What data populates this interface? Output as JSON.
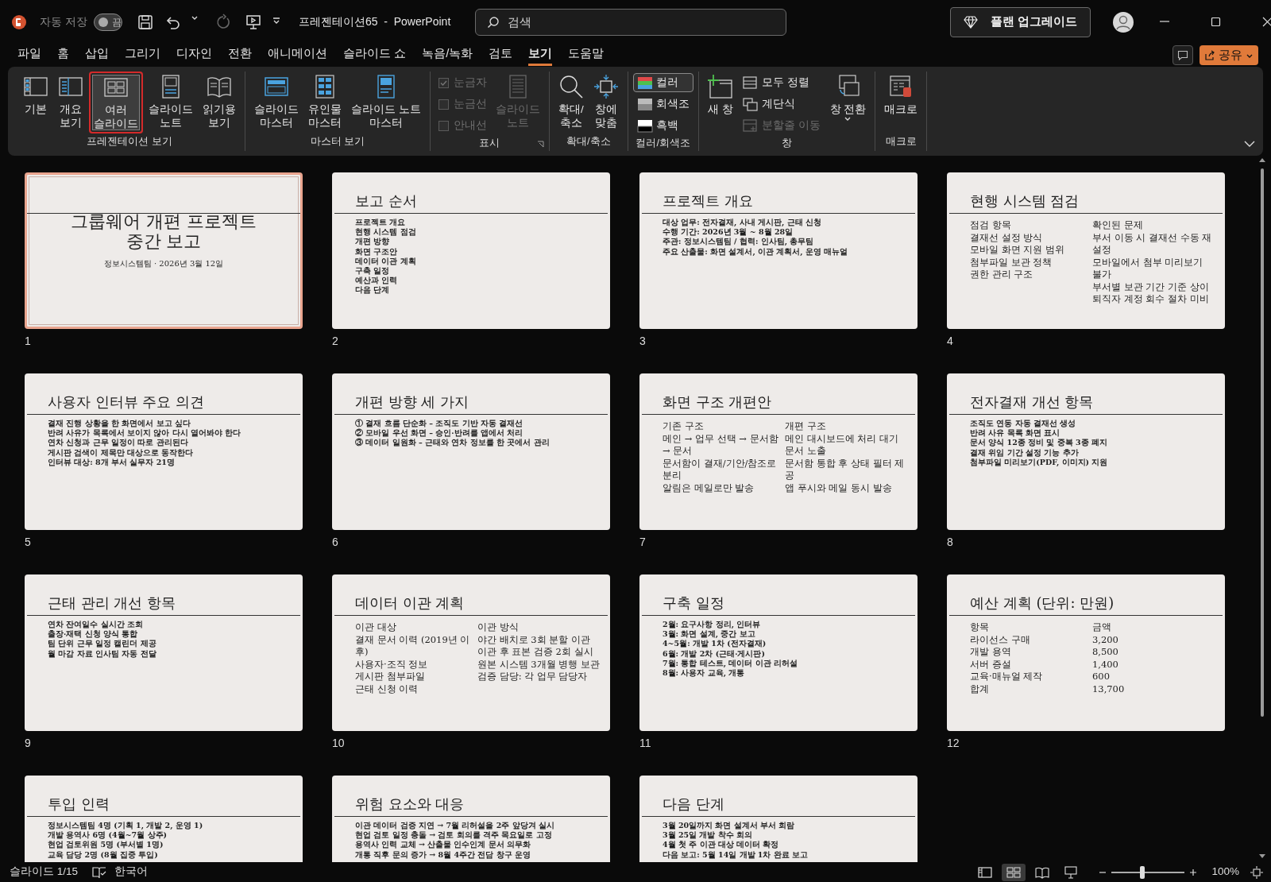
{
  "titlebar": {
    "autosave_label": "자동 저장",
    "autosave": {
      "on": false,
      "label": "끔"
    },
    "doc_title": "프레젠테이션65  -  PowerPoint",
    "search": {
      "placeholder": "검색"
    },
    "upgrade_button": "플랜 업그레이드"
  },
  "menu_tabs": [
    {
      "label": "파일",
      "selected": false
    },
    {
      "label": "홈",
      "selected": false
    },
    {
      "label": "삽입",
      "selected": false
    },
    {
      "label": "그리기",
      "selected": false
    },
    {
      "label": "디자인",
      "selected": false
    },
    {
      "label": "전환",
      "selected": false
    },
    {
      "label": "애니메이션",
      "selected": false
    },
    {
      "label": "슬라이드 쇼",
      "selected": false
    },
    {
      "label": "녹음/녹화",
      "selected": false
    },
    {
      "label": "검토",
      "selected": false
    },
    {
      "label": "보기",
      "selected": true
    },
    {
      "label": "도움말",
      "selected": false
    }
  ],
  "share_button": "공유",
  "ribbon_groups": [
    {
      "label": "프레젠테이션 보기",
      "launcher": false,
      "items": [
        {
          "kind": "large",
          "label": "기본",
          "disabled": false,
          "selected": false
        },
        {
          "kind": "large",
          "label": "개요\n보기",
          "disabled": false,
          "selected": false
        },
        {
          "kind": "large",
          "label": "여러\n슬라이드",
          "disabled": false,
          "selected": true
        },
        {
          "kind": "large",
          "label": "슬라이드\n노트",
          "disabled": false,
          "selected": false
        },
        {
          "kind": "large",
          "label": "읽기용\n보기",
          "disabled": false,
          "selected": false
        }
      ]
    },
    {
      "label": "마스터 보기",
      "launcher": false,
      "items": [
        {
          "kind": "large",
          "label": "슬라이드\n마스터",
          "disabled": false,
          "selected": false
        },
        {
          "kind": "large",
          "label": "유인물\n마스터",
          "disabled": false,
          "selected": false
        },
        {
          "kind": "large",
          "label": "슬라이드 노트\n마스터",
          "disabled": false,
          "selected": false
        }
      ]
    },
    {
      "label": "표시",
      "launcher": true,
      "items": [
        {
          "kind": "check",
          "label": "눈금자",
          "disabled": true,
          "checked": true
        },
        {
          "kind": "check",
          "label": "눈금선",
          "disabled": true,
          "checked": false
        },
        {
          "kind": "check",
          "label": "안내선",
          "disabled": true,
          "checked": false
        },
        {
          "kind": "large",
          "label": "슬라이드\n노트",
          "disabled": true,
          "selected": false
        }
      ]
    },
    {
      "label": "확대/축소",
      "launcher": false,
      "items": [
        {
          "kind": "large",
          "label": "확대/\n축소",
          "disabled": false,
          "selected": false
        },
        {
          "kind": "large",
          "label": "창에\n맞춤",
          "disabled": false,
          "selected": false
        }
      ]
    },
    {
      "label": "컬러/회색조",
      "launcher": false,
      "items": [
        {
          "kind": "small",
          "label": "컬러",
          "disabled": false,
          "selected": true
        },
        {
          "kind": "small",
          "label": "회색조",
          "disabled": false,
          "selected": false
        },
        {
          "kind": "small",
          "label": "흑백",
          "disabled": false,
          "selected": false
        }
      ]
    },
    {
      "label": "창",
      "launcher": false,
      "items": [
        {
          "kind": "large",
          "label": "새 창",
          "disabled": false,
          "selected": false
        },
        {
          "kind": "small",
          "label": "모두 정렬",
          "disabled": false,
          "selected": false
        },
        {
          "kind": "small",
          "label": "계단식",
          "disabled": false,
          "selected": false
        },
        {
          "kind": "small",
          "label": "분할줄 이동",
          "disabled": true,
          "selected": false
        },
        {
          "kind": "large",
          "label": "창 전환",
          "disabled": false,
          "selected": false,
          "dropdown": true
        }
      ]
    },
    {
      "label": "매크로",
      "launcher": false,
      "items": [
        {
          "kind": "large",
          "label": "매크로",
          "disabled": false,
          "selected": false
        }
      ]
    }
  ],
  "slides": [
    {
      "number": "1",
      "kind": "title",
      "selected": true,
      "title_lines": [
        "그룹웨어 개편 프로젝트",
        "중간 보고"
      ],
      "subtitle": "정보시스템팀 · 2026년 3월 12일"
    },
    {
      "number": "2",
      "kind": "list",
      "selected": false,
      "title": "보고 순서",
      "lines": [
        "프로젝트 개요",
        "현행 시스템 점검",
        "개편 방향",
        "화면 구조안",
        "데이터 이관 계획",
        "구축 일정",
        "예산과 인력",
        "다음 단계"
      ]
    },
    {
      "number": "3",
      "kind": "list",
      "selected": false,
      "title": "프로젝트 개요",
      "lines": [
        "대상 업무: 전자결재, 사내 게시판, 근태 신청",
        "수행 기간: 2026년 3월 ~ 8월 28일",
        "주관: 정보시스템팀 / 협력: 인사팀, 총무팀",
        "주요 산출물: 화면 설계서, 이관 계획서, 운영 매뉴얼"
      ]
    },
    {
      "number": "4",
      "kind": "two_column",
      "selected": false,
      "title": "현행 시스템 점검",
      "columns": [
        [
          "점검 항목",
          "결재선 설정 방식",
          "모바일 화면 지원 범위",
          "첨부파일 보관 정책",
          "권한 관리 구조"
        ],
        [
          "확인된 문제",
          "부서 이동 시 결재선 수동 재설정",
          "모바일에서 첨부 미리보기 불가",
          "부서별 보관 기간 기준 상이",
          "퇴직자 계정 회수 절차 미비"
        ]
      ]
    },
    {
      "number": "5",
      "kind": "list",
      "selected": false,
      "title": "사용자 인터뷰 주요 의견",
      "lines": [
        "결재 진행 상황을 한 화면에서 보고 싶다",
        "반려 사유가 목록에서 보이지 않아 다시 열어봐야 한다",
        "연차 신청과 근무 일정이 따로 관리된다",
        "게시판 검색이 제목만 대상으로 동작한다",
        "인터뷰 대상: 8개 부서 실무자 21명"
      ]
    },
    {
      "number": "6",
      "kind": "list",
      "selected": false,
      "title": "개편 방향 세 가지",
      "lines": [
        "① 결재 흐름 단순화 – 조직도 기반 자동 결재선",
        "② 모바일 우선 화면 – 승인·반려를 앱에서 처리",
        "③ 데이터 일원화 – 근태와 연차 정보를 한 곳에서 관리"
      ]
    },
    {
      "number": "7",
      "kind": "two_column",
      "selected": false,
      "title": "화면 구조 개편안",
      "columns": [
        [
          "기존 구조",
          "메인 → 업무 선택 → 문서함 → 문서",
          "문서함이 결재/기안/참조로 분리",
          "알림은 메일로만 발송"
        ],
        [
          "개편 구조",
          "메인 대시보드에 처리 대기 문서 노출",
          "문서함 통합 후 상태 필터 제공",
          "앱 푸시와 메일 동시 발송"
        ]
      ]
    },
    {
      "number": "8",
      "kind": "list",
      "selected": false,
      "title": "전자결재 개선 항목",
      "lines": [
        "조직도 연동 자동 결재선 생성",
        "반려 사유 목록 화면 표시",
        "문서 양식 12종 정비 및 중복 3종 폐지",
        "결재 위임 기간 설정 기능 추가",
        "첨부파일 미리보기(PDF, 이미지) 지원"
      ]
    },
    {
      "number": "9",
      "kind": "list",
      "selected": false,
      "title": "근태 관리 개선 항목",
      "lines": [
        "연차 잔여일수 실시간 조회",
        "출장·재택 신청 양식 통합",
        "팀 단위 근무 일정 캘린더 제공",
        "월 마감 자료 인사팀 자동 전달"
      ]
    },
    {
      "number": "10",
      "kind": "two_column",
      "selected": false,
      "title": "데이터 이관 계획",
      "columns": [
        [
          "이관 대상",
          "결재 문서 이력 (2019년 이후)",
          "사용자·조직 정보",
          "게시판 첨부파일",
          "근태 신청 이력"
        ],
        [
          "이관 방식",
          "야간 배치로 3회 분할 이관",
          "이관 후 표본 검증 2회 실시",
          "원본 시스템 3개월 병행 보관",
          "검증 담당: 각 업무 담당자"
        ]
      ]
    },
    {
      "number": "11",
      "kind": "list",
      "selected": false,
      "title": "구축 일정",
      "lines": [
        "2월: 요구사항 정리, 인터뷰",
        "3월: 화면 설계, 중간 보고",
        "4~5월: 개발 1차 (전자결재)",
        "6월: 개발 2차 (근태·게시판)",
        "7월: 통합 테스트, 데이터 이관 리허설",
        "8월: 사용자 교육, 개통"
      ]
    },
    {
      "number": "12",
      "kind": "two_column",
      "selected": false,
      "title": "예산 계획 (단위: 만원)",
      "columns": [
        [
          "항목",
          "라이선스 구매",
          "개발 용역",
          "서버 증설",
          "교육·매뉴얼 제작",
          "합계"
        ],
        [
          "금액",
          "3,200",
          "8,500",
          "1,400",
          "600",
          "13,700"
        ]
      ]
    },
    {
      "kind": "list",
      "selected": false,
      "title": "투입 인력",
      "lines": [
        "정보시스템팀 4명 (기획 1, 개발 2, 운영 1)",
        "개발 용역사 6명 (4월~7월 상주)",
        "현업 검토위원 5명 (부서별 1명)",
        "교육 담당 2명 (8월 집중 투입)"
      ]
    },
    {
      "kind": "list",
      "selected": false,
      "title": "위험 요소와 대응",
      "lines": [
        "이관 데이터 검증 지연 → 7월 리허설을 2주 앞당겨 실시",
        "현업 검토 일정 충돌 → 검토 회의를 격주 목요일로 고정",
        "용역사 인력 교체 → 산출물 인수인계 문서 의무화",
        "개통 직후 문의 증가 → 8월 4주간 전담 창구 운영"
      ]
    },
    {
      "kind": "list",
      "selected": false,
      "title": "다음 단계",
      "lines": [
        "3월 20일까지 화면 설계서 부서 회람",
        "3월 25일 개발 착수 회의",
        "4월 첫 주 이관 대상 데이터 확정",
        "다음 보고: 5월 14일 개발 1차 완료 보고"
      ]
    }
  ],
  "status_bar": {
    "slide_counter": "슬라이드 1/15",
    "language": "한국어",
    "view_buttons": [
      {
        "selected": false
      },
      {
        "selected": true
      },
      {
        "selected": false
      },
      {
        "selected": false
      }
    ],
    "zoom": {
      "level": 0.42,
      "reading": "100%"
    }
  }
}
